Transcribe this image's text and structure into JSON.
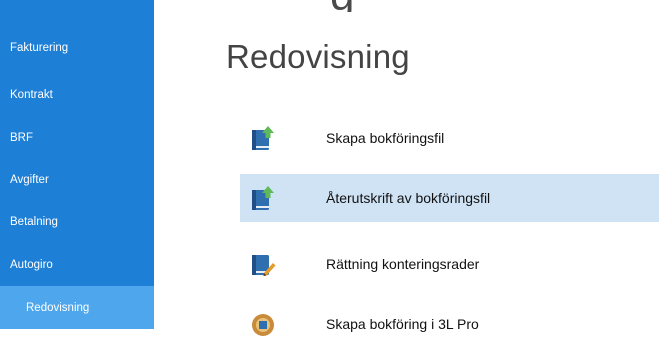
{
  "header": {
    "top_fragment": "g"
  },
  "sidebar": {
    "items": [
      {
        "label": "Fakturering"
      },
      {
        "label": "Kontrakt"
      },
      {
        "label": "BRF"
      },
      {
        "label": "Avgifter"
      },
      {
        "label": "Betalning"
      },
      {
        "label": "Autogiro"
      },
      {
        "label": "Redovisning",
        "active": true
      }
    ]
  },
  "main": {
    "title": "Redovisning",
    "actions": [
      {
        "label": "Skapa bokföringsfil",
        "icon": "book-upload-icon"
      },
      {
        "label": "Återutskrift av bokföringsfil",
        "icon": "book-upload-icon",
        "selected": true
      },
      {
        "label": "Rättning konteringsrader",
        "icon": "book-edit-icon"
      },
      {
        "label": "Skapa bokföring i 3L Pro",
        "icon": "3l-pro-icon"
      }
    ]
  },
  "colors": {
    "sidebar_bg": "#1e7fd6",
    "sidebar_active_bg": "#4ea7ec",
    "selected_row_bg": "#cfe3f5"
  }
}
